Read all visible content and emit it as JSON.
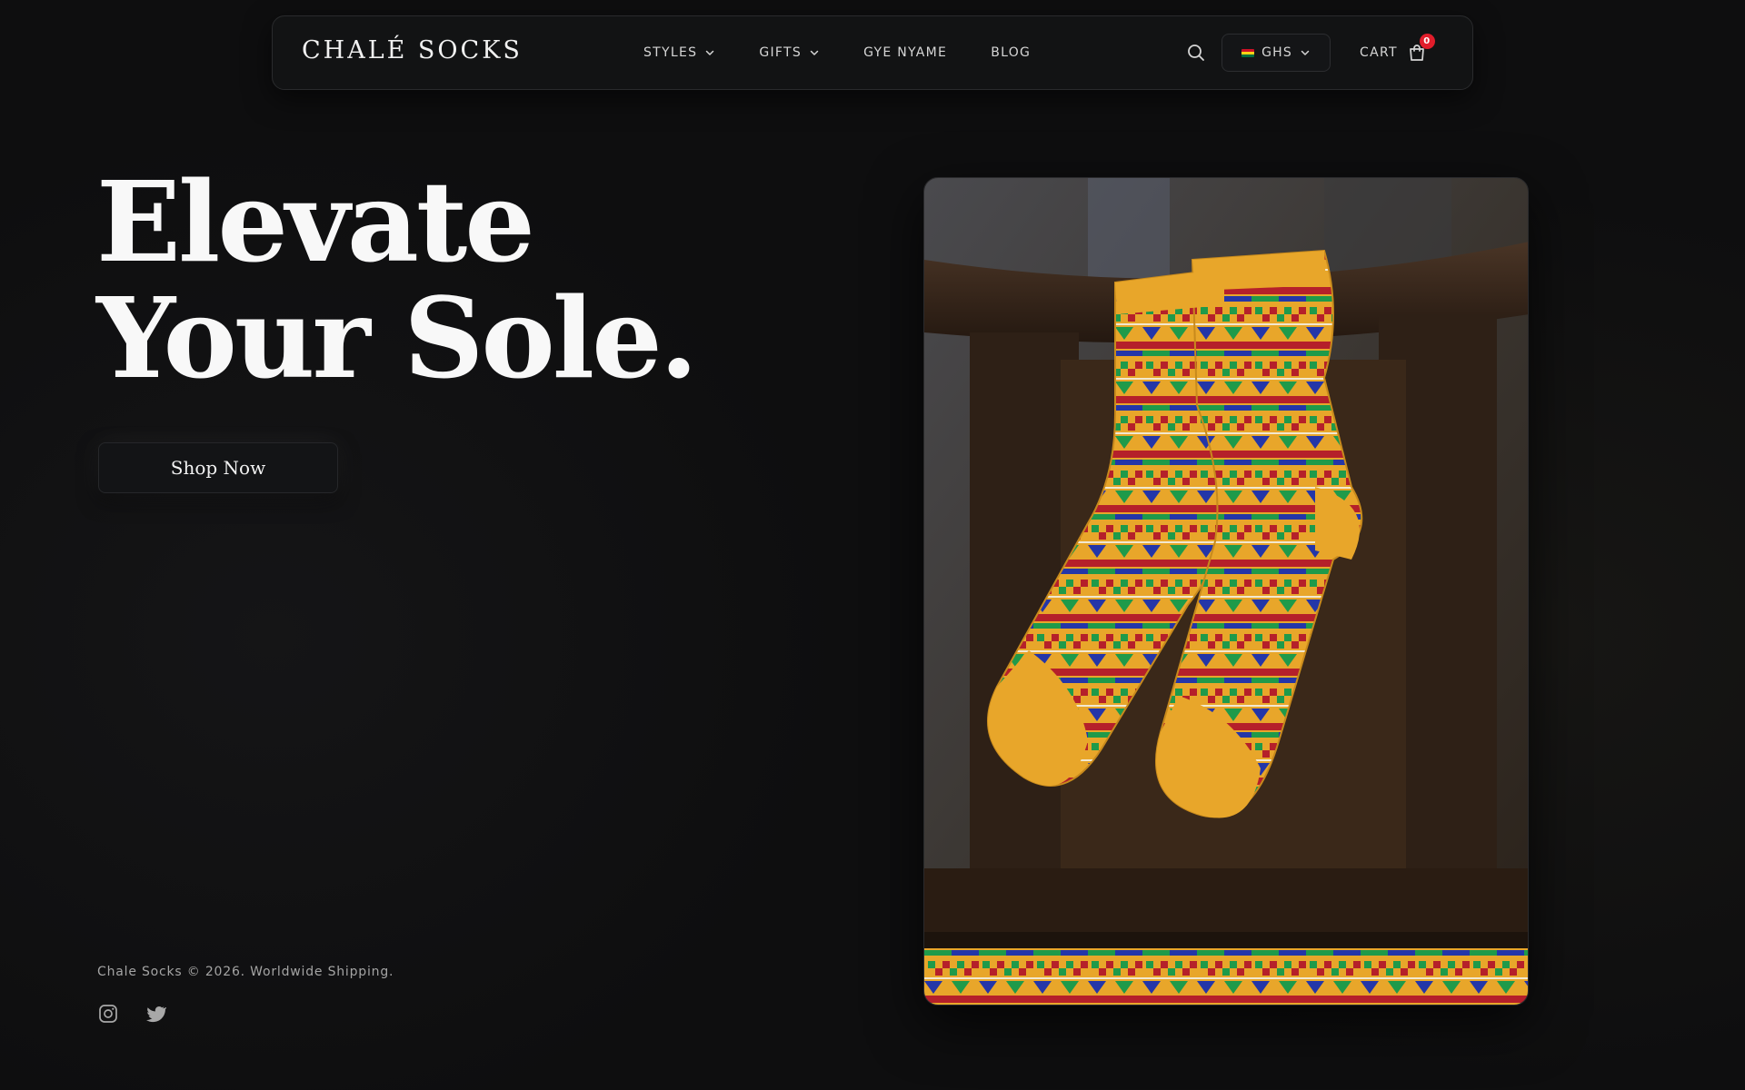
{
  "nav": {
    "logo": "CHALÉ SOCKS",
    "links": [
      {
        "label": "STYLES",
        "has_dropdown": true
      },
      {
        "label": "GIFTS",
        "has_dropdown": true
      },
      {
        "label": "GYE NYAME",
        "has_dropdown": false
      },
      {
        "label": "BLOG",
        "has_dropdown": false
      }
    ],
    "currency": "GHS",
    "cart_label": "CART",
    "cart_count": "0"
  },
  "hero": {
    "title_line1": "Elevate",
    "title_line2": "Your Sole.",
    "cta_label": "Shop Now",
    "image_icon": "kente-socks-photo"
  },
  "footer": {
    "copyright": "Chale Socks © 2026. Worldwide Shipping.",
    "social": [
      "instagram-icon",
      "twitter-icon"
    ]
  },
  "colors": {
    "background": "#0e0e0f",
    "badge": "#e11d2b",
    "kente_gold": "#e8a62a",
    "kente_green": "#1f9a4a",
    "kente_blue": "#2436a8",
    "kente_red": "#b5202a"
  }
}
